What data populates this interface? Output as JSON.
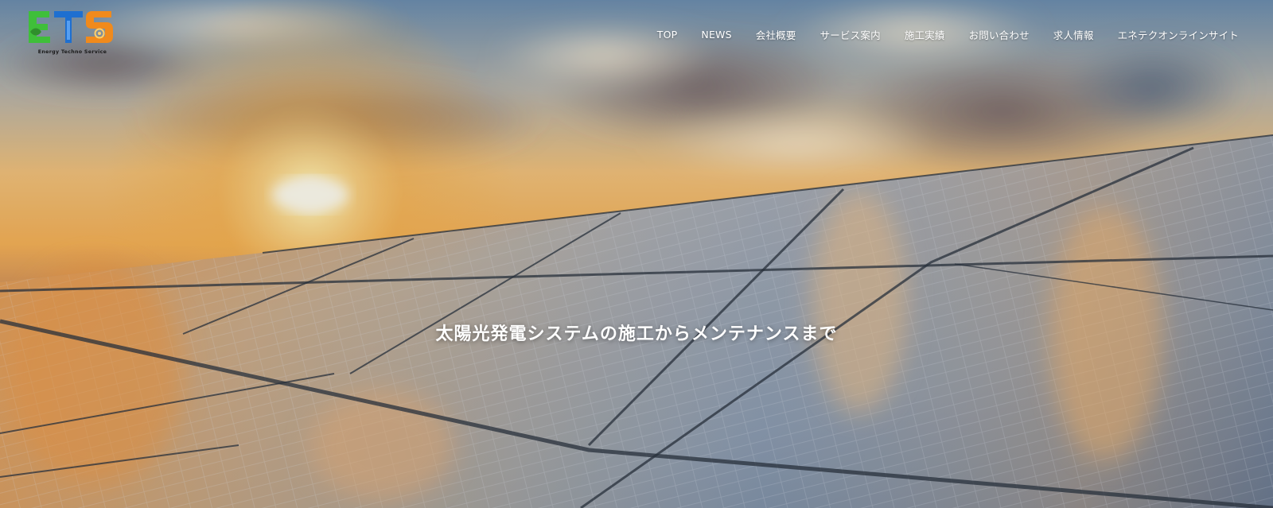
{
  "brand": {
    "logo_letters": "ETS",
    "logo_caption": "Energy Techno Service",
    "colors": {
      "e_green": "#3fbf3a",
      "t_blue": "#1e6fd0",
      "s_orange": "#f08a1c"
    }
  },
  "nav": {
    "items": [
      {
        "label": "TOP"
      },
      {
        "label": "NEWS"
      },
      {
        "label": "会社概要"
      },
      {
        "label": "サービス案内"
      },
      {
        "label": "施工実績"
      },
      {
        "label": "お問い合わせ"
      },
      {
        "label": "求人情報"
      },
      {
        "label": "エネテクオンラインサイト"
      }
    ]
  },
  "hero": {
    "tagline": "太陽光発電システムの施工からメンテナンスまで",
    "background": "sunset-sky-over-solar-panels"
  }
}
